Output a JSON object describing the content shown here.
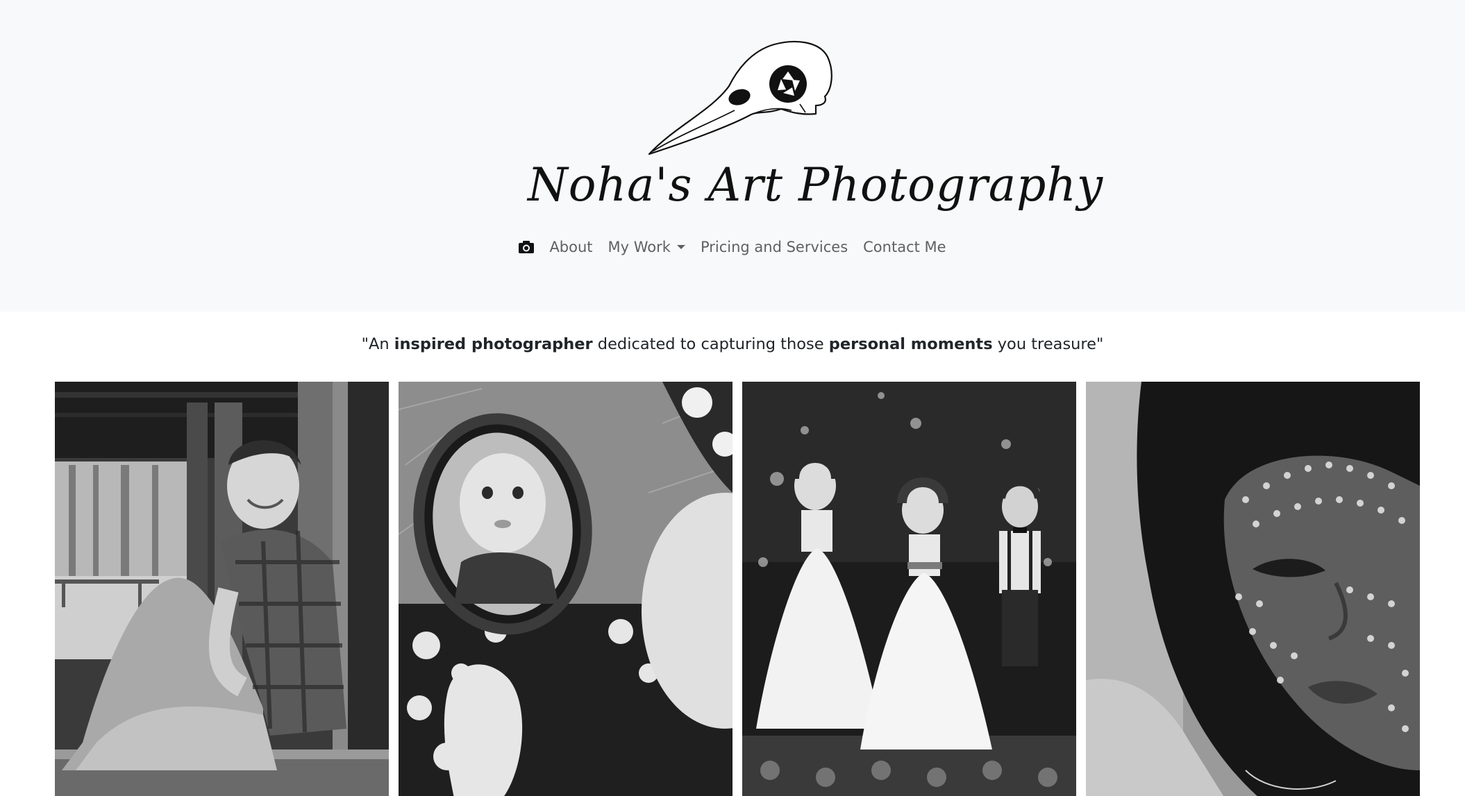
{
  "brand": {
    "name": "Noha's Art Photography",
    "logo_icon": "bird-skull-camera-icon"
  },
  "nav": {
    "home_icon": "camera-icon",
    "items": [
      {
        "label": "About"
      },
      {
        "label": "My Work",
        "dropdown": true
      },
      {
        "label": "Pricing and Services"
      },
      {
        "label": "Contact Me"
      }
    ]
  },
  "tagline": {
    "open_quote": "\"An ",
    "strong1": "inspired photographer",
    "middle": " dedicated to capturing those ",
    "strong2": "personal moments",
    "end": " you treasure\""
  },
  "gallery": [
    {
      "subject": "boy-sitting-photo"
    },
    {
      "subject": "baby-mirror-photo"
    },
    {
      "subject": "flower-girls-photo"
    },
    {
      "subject": "woman-portrait-photo"
    }
  ],
  "colors": {
    "header_bg": "#f8f9fa",
    "nav_text": "#5f6163",
    "body_text": "#212529"
  }
}
